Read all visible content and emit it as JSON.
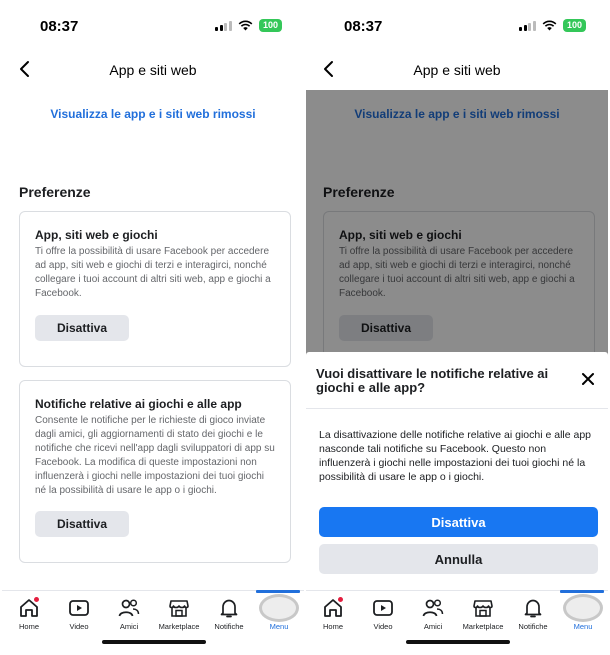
{
  "status": {
    "time": "08:37",
    "battery": "100"
  },
  "nav": {
    "title": "App e siti web"
  },
  "link": "Visualizza le app e i siti web rimossi",
  "preferences": {
    "title": "Preferenze",
    "cards": [
      {
        "title": "App, siti web e giochi",
        "description": "Ti offre la possibilità di usare Facebook per accedere ad app, siti web e giochi di terzi e interagirci, nonché collegare i tuoi account di altri siti web, app e giochi a Facebook.",
        "button": "Disattiva"
      },
      {
        "title": "Notifiche relative ai giochi e alle app",
        "description": "Consente le notifiche per le richieste di gioco inviate dagli amici, gli aggiornamenti di stato dei giochi e le notifiche che ricevi nell'app dagli sviluppatori di app su Facebook. La modifica di queste impostazioni non influenzerà i giochi nelle impostazioni dei tuoi giochi né la possibilità di usare le app o i giochi.",
        "button": "Disattiva"
      }
    ]
  },
  "tabs": [
    {
      "label": "Home",
      "icon": "home-icon"
    },
    {
      "label": "Video",
      "icon": "video-icon"
    },
    {
      "label": "Amici",
      "icon": "friends-icon"
    },
    {
      "label": "Marketplace",
      "icon": "marketplace-icon"
    },
    {
      "label": "Notifiche",
      "icon": "bell-icon"
    },
    {
      "label": "Menu",
      "icon": "menu-icon",
      "active": true
    }
  ],
  "dialog": {
    "title": "Vuoi disattivare le notifiche relative ai giochi e alle app?",
    "body": "La disattivazione delle notifiche relative ai giochi e alle app nasconde tali notifiche su Facebook. Questo non influenzerà i giochi nelle impostazioni dei tuoi giochi né la possibilità di usare le app o i giochi.",
    "confirm": "Disattiva",
    "cancel": "Annulla"
  },
  "colors": {
    "accent": "#1877f2",
    "link": "#216fdb",
    "battery": "#34c759",
    "badge": "#e41e3f"
  }
}
